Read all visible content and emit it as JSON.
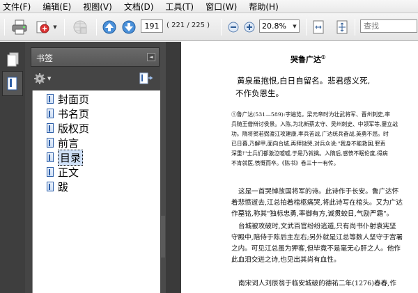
{
  "menu": [
    {
      "label": "文件(F)"
    },
    {
      "label": "编辑(E)"
    },
    {
      "label": "视图(V)"
    },
    {
      "label": "文档(D)"
    },
    {
      "label": "工具(T)"
    },
    {
      "label": "窗口(W)"
    },
    {
      "label": "帮助(H)"
    }
  ],
  "toolbar": {
    "page_current": "191",
    "page_count": "( 221 / 225 )",
    "zoom": "20.8%",
    "search_placeholder": "查找"
  },
  "panel": {
    "title": "书签"
  },
  "bookmarks": [
    {
      "label": "封面页"
    },
    {
      "label": "书名页"
    },
    {
      "label": "版权页"
    },
    {
      "label": "前言"
    },
    {
      "label": "目录"
    },
    {
      "label": "正文"
    },
    {
      "label": "跋"
    }
  ],
  "selected_bookmark": "目录",
  "document": {
    "title": "哭鲁广达",
    "title_note": "①",
    "poem": [
      "黄泉虽抱恨,白日自留名。悲君感义死,",
      "不作负恩生。"
    ],
    "notes": [
      "①鲁广达(531—589):字遍览。梁元帝时为壮武将军、晋州刺史,率",
      "兵随王僧辩讨侯景。入陈,为北新蔡太守、吴州刺史、中领军等,屡立战",
      "功。隋将贺若弼渡江攻建康,率兵苦战,广达统兵奋战,英勇不屈。时",
      "已日暮,乃解甲,面向台城,再拜恸哭,对兵众说:\"我身不能救国,罪责",
      "深重!\"士兵们都激泣嘘嘘,于是乃就擒。入隋后,感愤不眠伦度,得病",
      "不肯就医,愤慨而卒。《陈书》卷三十一有传。"
    ],
    "body": [
      "这是一首哭悼故国将军的诗。此诗作于长安。鲁广达怀",
      "着悲愤逝去,江总拍着棺柩痛哭,将此诗写在棺头。又为广达",
      "作墓铭,称其\"独标忠勇,率御有方,诚贯蛟日,气励严霜\"。",
      "台城被攻破时,文武百官纷纷逃遁,只有尚书仆射袁宪坚",
      "守殿中,陪侍于陈后主左右;另外就是江总等数人坚守于宫署",
      "之内。可见江总虽为狎客,但毕竟不是毫无心肝之人。他作",
      "此血泪交迸之诗,也见出其尚有血性。"
    ],
    "bottom_line": "南宋词人刘辰翁于临安城破的德祐二年(1276)春春,作"
  }
}
